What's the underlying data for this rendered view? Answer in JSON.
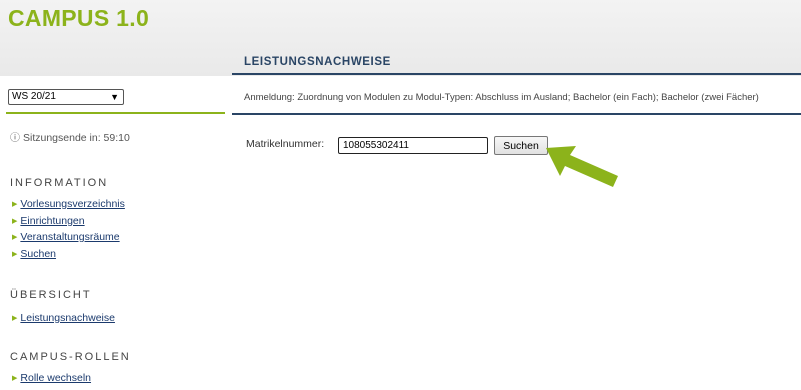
{
  "header": {
    "logo": "CAMPUS 1.0",
    "page_title": "LEISTUNGSNACHWEISE"
  },
  "sidebar": {
    "semester_select": {
      "value": "WS 20/21"
    },
    "session": {
      "icon": "info-icon",
      "text": "Sitzungsende in: 59:10"
    },
    "sections": [
      {
        "title": "INFORMATION",
        "items": [
          {
            "label": "Vorlesungsverzeichnis"
          },
          {
            "label": "Einrichtungen"
          },
          {
            "label": "Veranstaltungsräume"
          },
          {
            "label": "Suchen"
          }
        ]
      },
      {
        "title": "ÜBERSICHT",
        "items": [
          {
            "label": "Leistungsnachweise"
          }
        ]
      },
      {
        "title": "CAMPUS-ROLLEN",
        "items": [
          {
            "label": "Rolle wechseln"
          }
        ]
      }
    ]
  },
  "main": {
    "anmeldung_text": "Anmeldung: Zuordnung von Modulen zu Modul-Typen: Abschluss im Ausland; Bachelor (ein Fach); Bachelor (zwei Fächer)",
    "matrikel_label": "Matrikelnummer:",
    "matrikel_value": "108055302411",
    "search_button": "Suchen",
    "annotation_arrow_icon": "green-arrow-icon"
  },
  "colors": {
    "accent_green": "#8cb31b",
    "title_blue": "#2a4565",
    "link_blue": "#1b3a6d"
  }
}
